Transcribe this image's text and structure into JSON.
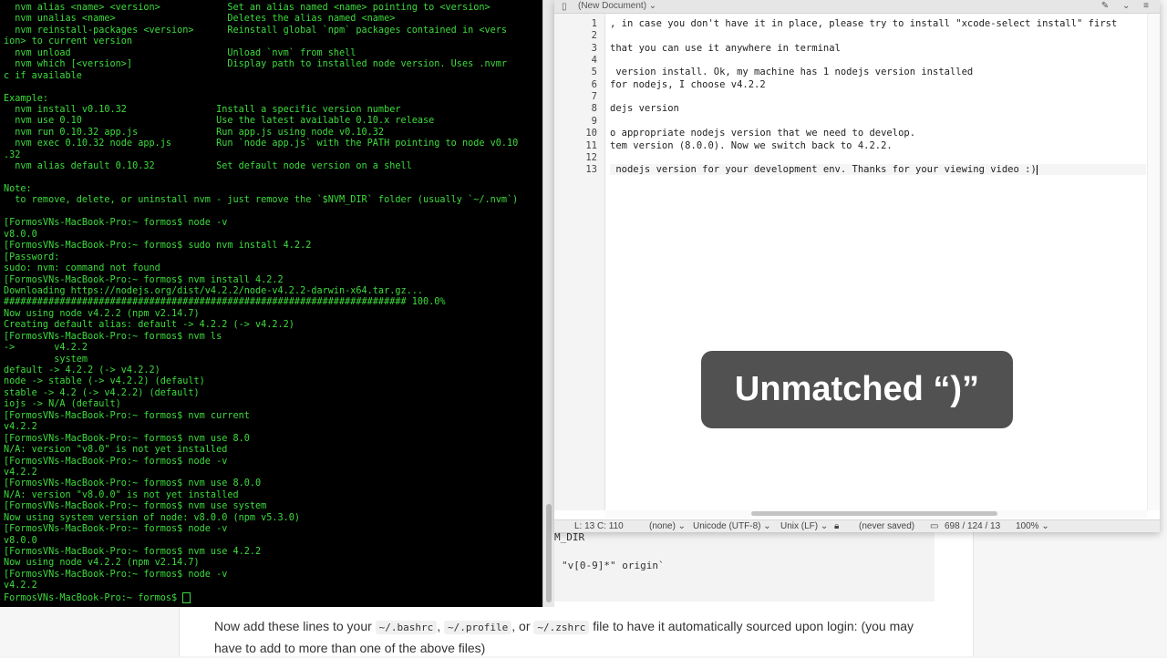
{
  "terminal": {
    "lines": [
      "  nvm alias <name> <version>            Set an alias named <name> pointing to <version>",
      "  nvm unalias <name>                    Deletes the alias named <name>",
      "  nvm reinstall-packages <version>      Reinstall global `npm` packages contained in <vers",
      "ion> to current version",
      "  nvm unload                            Unload `nvm` from shell",
      "  nvm which [<version>]                 Display path to installed node version. Uses .nvmr",
      "c if available",
      "",
      "Example:",
      "  nvm install v0.10.32                Install a specific version number",
      "  nvm use 0.10                        Use the latest available 0.10.x release",
      "  nvm run 0.10.32 app.js              Run app.js using node v0.10.32",
      "  nvm exec 0.10.32 node app.js        Run `node app.js` with the PATH pointing to node v0.10",
      ".32",
      "  nvm alias default 0.10.32           Set default node version on a shell",
      "",
      "Note:",
      "  to remove, delete, or uninstall nvm - just remove the `$NVM_DIR` folder (usually `~/.nvm`)",
      "",
      "[FormosVNs-MacBook-Pro:~ formos$ node -v",
      "v8.0.0",
      "[FormosVNs-MacBook-Pro:~ formos$ sudo nvm install 4.2.2",
      "[Password:",
      "sudo: nvm: command not found",
      "[FormosVNs-MacBook-Pro:~ formos$ nvm install 4.2.2",
      "Downloading https://nodejs.org/dist/v4.2.2/node-v4.2.2-darwin-x64.tar.gz...",
      "######################################################################## 100.0%",
      "Now using node v4.2.2 (npm v2.14.7)",
      "Creating default alias: default -> 4.2.2 (-> v4.2.2)",
      "[FormosVNs-MacBook-Pro:~ formos$ nvm ls",
      "->       v4.2.2",
      "         system",
      "default -> 4.2.2 (-> v4.2.2)",
      "node -> stable (-> v4.2.2) (default)",
      "stable -> 4.2 (-> v4.2.2) (default)",
      "iojs -> N/A (default)",
      "[FormosVNs-MacBook-Pro:~ formos$ nvm current",
      "v4.2.2",
      "[FormosVNs-MacBook-Pro:~ formos$ nvm use 8.0",
      "N/A: version \"v8.0\" is not yet installed",
      "[FormosVNs-MacBook-Pro:~ formos$ node -v",
      "v4.2.2",
      "[FormosVNs-MacBook-Pro:~ formos$ nvm use 8.0.0",
      "N/A: version \"v8.0.0\" is not yet installed",
      "[FormosVNs-MacBook-Pro:~ formos$ nvm use system",
      "Now using system version of node: v8.0.0 (npm v5.3.0)",
      "[FormosVNs-MacBook-Pro:~ formos$ node -v",
      "v8.0.0",
      "[FormosVNs-MacBook-Pro:~ formos$ nvm use 4.2.2",
      "Now using node v4.2.2 (npm v2.14.7)",
      "[FormosVNs-MacBook-Pro:~ formos$ node -v",
      "v4.2.2"
    ],
    "prompt": "FormosVNs-MacBook-Pro:~ formos$ "
  },
  "editor": {
    "title": "(New Document) ⌄",
    "title_icons": "✎ ⌄ ≡",
    "line_numbers": [
      "1",
      "2",
      "3",
      "4",
      "5",
      "6",
      "7",
      "8",
      "9",
      "10",
      "11",
      "12",
      "13"
    ],
    "lines": [
      ", in case you don't have it in place, please try to install \"xcode-select install\" first",
      "",
      "that you can use it anywhere in terminal",
      "",
      " version install. Ok, my machine has 1 nodejs version installed",
      "for nodejs, I choose v4.2.2",
      "",
      "dejs version",
      "",
      "o appropriate nodejs version that we need to develop.",
      "tem version (8.0.0). Now we switch back to 4.2.2.",
      "",
      " nodejs version for your development env. Thanks for your viewing video :)"
    ],
    "status": {
      "position": "L: 13 C: 110",
      "syntax": "(none) ⌄",
      "encoding": "Unicode (UTF-8) ⌄",
      "line_endings": "Unix (LF) ⌄",
      "saved": "(never saved)",
      "counts": "698 / 124 / 13",
      "zoom": "100% ⌄"
    }
  },
  "overlay": {
    "message": "Unmatched “)”"
  },
  "background_page": {
    "code_fragment_1": "M_DIR",
    "code_fragment_2": "\"v[0-9]*\" origin`",
    "text_before": "Now add these lines to your",
    "code_bashrc": "~/.bashrc",
    "sep1": ",",
    "code_profile": "~/.profile",
    "sep2": ", or",
    "code_zshrc": "~/.zshrc",
    "text_after": "file to have it automatically sourced upon login: (you may have to add to more than one of the above files)"
  }
}
